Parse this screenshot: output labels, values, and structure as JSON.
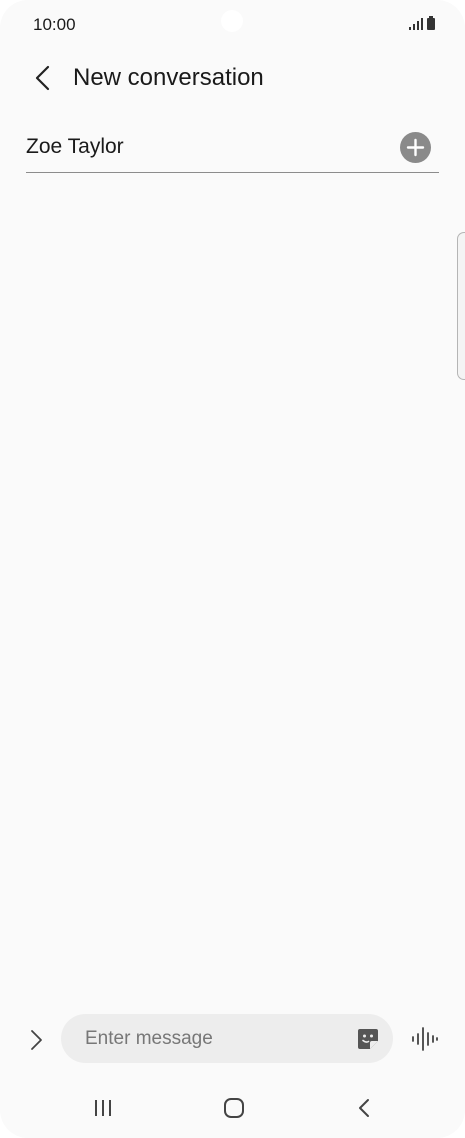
{
  "status_bar": {
    "time": "10:00",
    "icons": [
      "signal-icon",
      "battery-icon"
    ]
  },
  "header": {
    "back_icon": "chevron-left-icon",
    "title": "New conversation"
  },
  "recipient": {
    "name": "Zoe Taylor",
    "add_icon": "plus-circle-icon"
  },
  "composer": {
    "expand_icon": "chevron-right-icon",
    "message_placeholder": "Enter message",
    "message_value": "",
    "sticker_icon": "sticker-icon",
    "voice_icon": "voice-waveform-icon"
  },
  "nav_bar": {
    "items": [
      "recents-icon",
      "home-icon",
      "back-icon"
    ]
  },
  "colors": {
    "background": "#fafafa",
    "input_background": "#ededed",
    "add_button": "#8a8a8a",
    "text": "#1a1a1a"
  }
}
